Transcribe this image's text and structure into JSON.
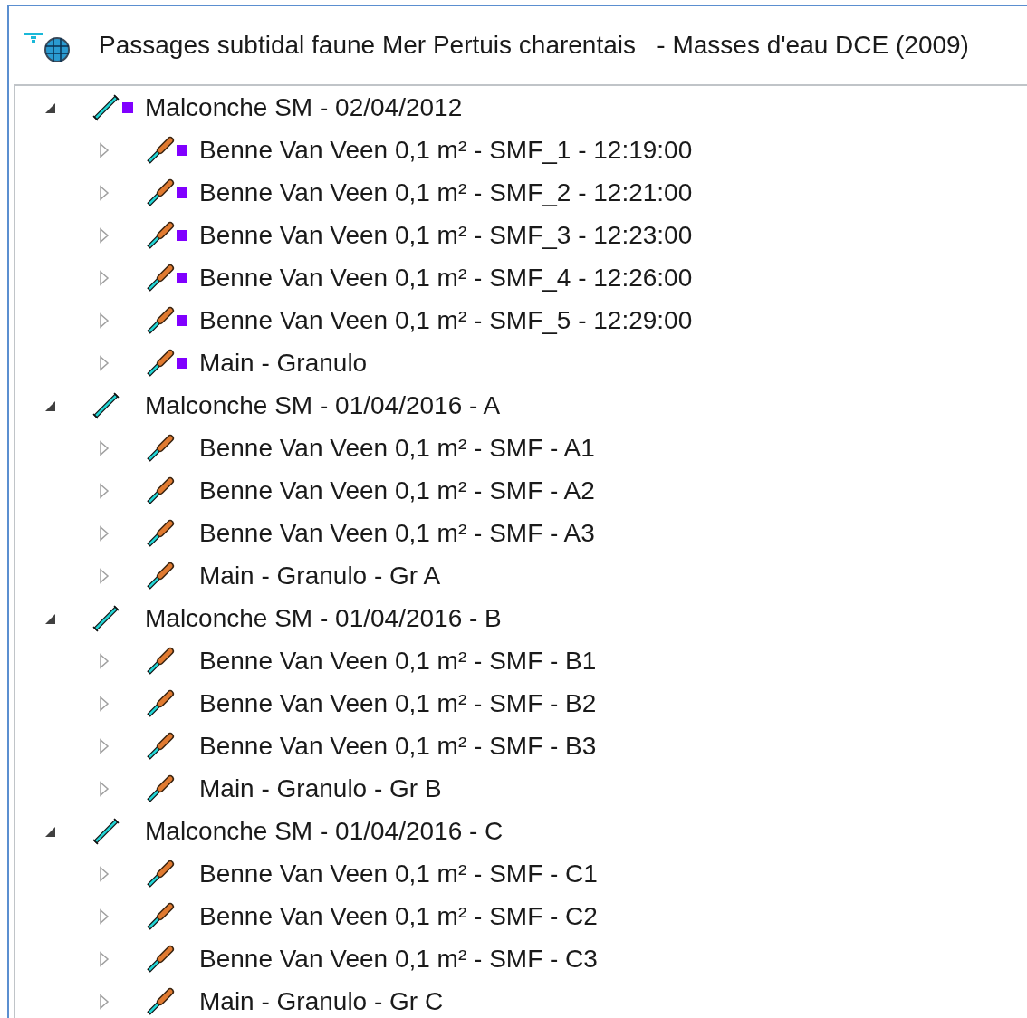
{
  "window": {
    "title": "Passages subtidal faune Mer Pertuis charentais   - Masses d'eau DCE (2009)"
  },
  "tree": [
    {
      "label": "Malconche SM - 02/04/2012",
      "expanded": true,
      "color": "#8000ff",
      "children": [
        {
          "label": "Benne Van Veen 0,1 m² - SMF_1 - 12:19:00",
          "expanded": false,
          "color": "#8000ff"
        },
        {
          "label": "Benne Van Veen 0,1 m² - SMF_2 - 12:21:00",
          "expanded": false,
          "color": "#8000ff"
        },
        {
          "label": "Benne Van Veen 0,1 m² - SMF_3 - 12:23:00",
          "expanded": false,
          "color": "#8000ff"
        },
        {
          "label": "Benne Van Veen 0,1 m² - SMF_4 - 12:26:00",
          "expanded": false,
          "color": "#8000ff"
        },
        {
          "label": "Benne Van Veen 0,1 m² - SMF_5 - 12:29:00",
          "expanded": false,
          "color": "#8000ff"
        },
        {
          "label": "Main - Granulo",
          "expanded": false,
          "color": "#8000ff"
        }
      ]
    },
    {
      "label": "Malconche SM - 01/04/2016 - A",
      "expanded": true,
      "children": [
        {
          "label": "Benne Van Veen 0,1 m² - SMF - A1",
          "expanded": false
        },
        {
          "label": "Benne Van Veen 0,1 m² - SMF - A2",
          "expanded": false
        },
        {
          "label": "Benne Van Veen 0,1 m² - SMF - A3",
          "expanded": false
        },
        {
          "label": "Main - Granulo - Gr A",
          "expanded": false
        }
      ]
    },
    {
      "label": "Malconche SM - 01/04/2016 - B",
      "expanded": true,
      "children": [
        {
          "label": "Benne Van Veen 0,1 m² - SMF - B1",
          "expanded": false
        },
        {
          "label": "Benne Van Veen 0,1 m² - SMF - B2",
          "expanded": false
        },
        {
          "label": "Benne Van Veen 0,1 m² - SMF - B3",
          "expanded": false
        },
        {
          "label": "Main - Granulo - Gr B",
          "expanded": false
        }
      ]
    },
    {
      "label": "Malconche SM - 01/04/2016 - C",
      "expanded": true,
      "children": [
        {
          "label": "Benne Van Veen 0,1 m² - SMF - C1",
          "expanded": false
        },
        {
          "label": "Benne Van Veen 0,1 m² - SMF - C2",
          "expanded": false
        },
        {
          "label": "Benne Van Veen 0,1 m² - SMF - C3",
          "expanded": false
        },
        {
          "label": "Main - Granulo - Gr C",
          "expanded": false
        }
      ]
    }
  ]
}
